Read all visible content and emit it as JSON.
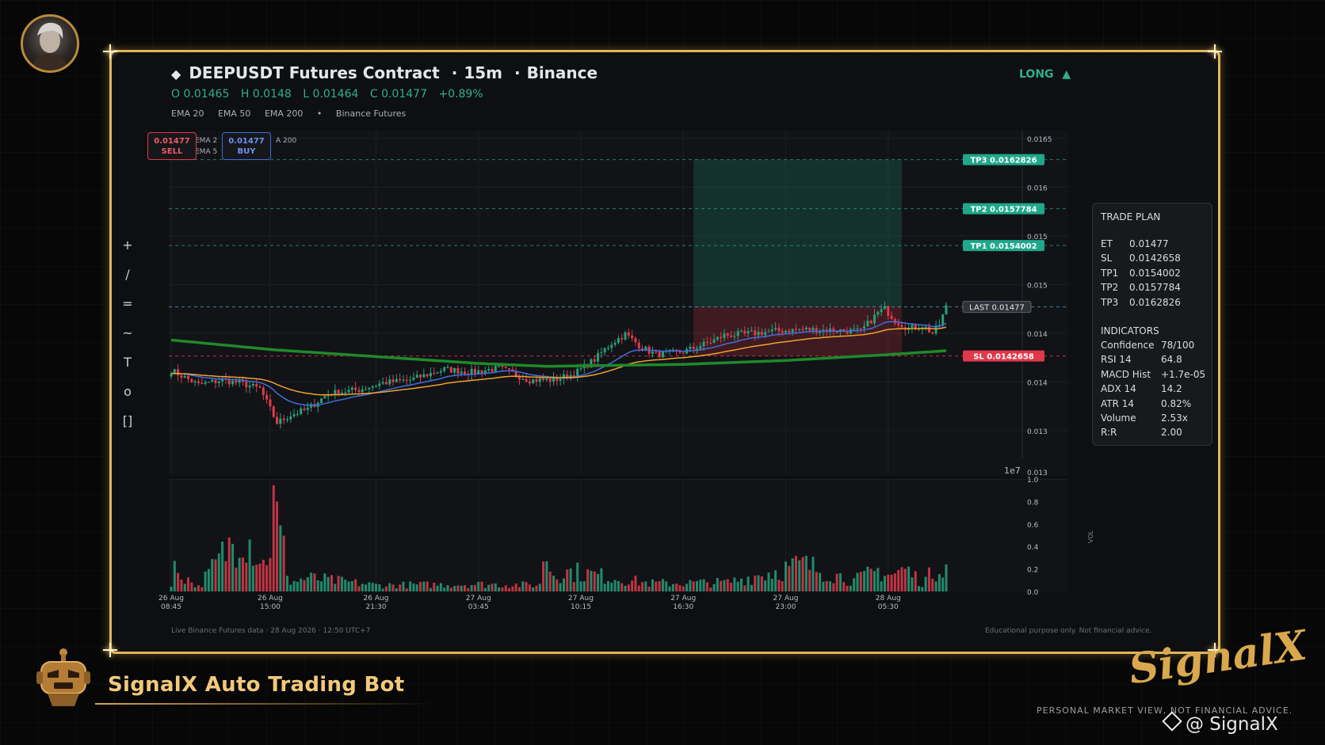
{
  "header": {
    "symbol_icon": "diamond-icon",
    "title": "DEEPUSDT Futures Contract",
    "interval": "15m",
    "exchange": "Binance",
    "ohlc": {
      "open": "O 0.01465",
      "high": "H 0.0148",
      "low": "L 0.01464",
      "close": "C 0.01477",
      "change": "+0.89%"
    },
    "indicators": [
      "EMA 20",
      "EMA 50",
      "EMA 200"
    ],
    "source": "Binance Futures",
    "separator": "·",
    "bullet": "•"
  },
  "signal": {
    "label": "LONG",
    "arrow": "▲",
    "color": "#2fb08a"
  },
  "toolbar": [
    "+",
    "/",
    "=",
    "~",
    "T",
    "o",
    "[]"
  ],
  "order_buttons": {
    "sell": {
      "price": "0.01477",
      "label": "SELL"
    },
    "buy": {
      "price": "0.01477",
      "label": "BUY"
    }
  },
  "legend_overlap": {
    "a": "EMA 2",
    "b": "EMA 5",
    "c": "A 200"
  },
  "price_tags": {
    "tp3": "TP3  0.0162826",
    "tp2": "TP2  0.0157784",
    "tp1": "TP1  0.0154002",
    "last": "LAST  0.01477",
    "sl": "SL  0.0142658"
  },
  "trade_plan": {
    "title": "TRADE PLAN",
    "rows": [
      {
        "k": "ET",
        "v": "0.01477"
      },
      {
        "k": "SL",
        "v": "0.0142658"
      },
      {
        "k": "TP1",
        "v": "0.0154002"
      },
      {
        "k": "TP2",
        "v": "0.0157784"
      },
      {
        "k": "TP3",
        "v": "0.0162826"
      }
    ],
    "ind_title": "INDICATORS",
    "indicators": [
      {
        "k": "Confidence",
        "v": "78/100"
      },
      {
        "k": "RSI 14",
        "v": "64.8"
      },
      {
        "k": "MACD Hist",
        "v": "+1.7e-05"
      },
      {
        "k": "ADX 14",
        "v": "14.2"
      },
      {
        "k": "ATR 14",
        "v": "0.82%"
      },
      {
        "k": "Volume",
        "v": "2.53x"
      },
      {
        "k": "R:R",
        "v": "2.00"
      }
    ]
  },
  "footer": {
    "left": "Live Binance Futures data  ·  28 Aug 2026 · 12:50 UTC+7",
    "right": "Educational purpose only. Not financial advice."
  },
  "branding": {
    "bot_title": "SignalX Auto Trading Bot",
    "logo_text": "SignalX",
    "note": "PERSONAL MARKET VIEW, NOT FINANCIAL ADVICE.",
    "handle": "@ SignalX"
  },
  "colors": {
    "up": "#26a17b",
    "down": "#e03b4a",
    "ema20": "#3f6fe0",
    "ema50": "#f0a22e",
    "ema200": "#1e8a2a",
    "tp": "#1fa88a",
    "sl": "#e0384a",
    "gold": "#e0b65a"
  },
  "chart_data": {
    "type": "candlestick",
    "price_axis": {
      "ticks": [
        "0.0165",
        "0.016",
        "0.015",
        "0.015",
        "0.014",
        "0.014",
        "0.013",
        "0.013"
      ],
      "ylim": [
        0.01306,
        0.01658
      ],
      "multiplier": "1e7"
    },
    "volume_axis": {
      "ticks": [
        "1.0",
        "0.8",
        "0.6",
        "0.4",
        "0.2",
        "0.0"
      ],
      "label": "VOL",
      "ylim": [
        0,
        1.0
      ]
    },
    "time_ticks": [
      "26 Aug\n08:45",
      "26 Aug\n15:00",
      "26 Aug\n21:30",
      "27 Aug\n03:45",
      "27 Aug\n10:15",
      "27 Aug\n16:30",
      "27 Aug\n23:00",
      "28 Aug\n05:30"
    ],
    "close_anchors": [
      [
        0,
        0.01412
      ],
      [
        8,
        0.01397
      ],
      [
        15,
        0.01402
      ],
      [
        21,
        0.01398
      ],
      [
        26,
        0.01393
      ],
      [
        29,
        0.01372
      ],
      [
        31,
        0.01358
      ],
      [
        35,
        0.01366
      ],
      [
        40,
        0.01372
      ],
      [
        46,
        0.01388
      ],
      [
        55,
        0.01392
      ],
      [
        62,
        0.01399
      ],
      [
        70,
        0.01402
      ],
      [
        80,
        0.01413
      ],
      [
        88,
        0.0141
      ],
      [
        96,
        0.01414
      ],
      [
        105,
        0.01402
      ],
      [
        112,
        0.01402
      ],
      [
        118,
        0.01408
      ],
      [
        124,
        0.01423
      ],
      [
        129,
        0.0144
      ],
      [
        133,
        0.01449
      ],
      [
        138,
        0.01435
      ],
      [
        142,
        0.01428
      ],
      [
        150,
        0.01431
      ],
      [
        158,
        0.01441
      ],
      [
        162,
        0.01448
      ],
      [
        168,
        0.01449
      ],
      [
        176,
        0.01452
      ],
      [
        185,
        0.01454
      ],
      [
        195,
        0.01453
      ],
      [
        202,
        0.01452
      ],
      [
        207,
        0.01471
      ],
      [
        209,
        0.01475
      ],
      [
        212,
        0.01463
      ],
      [
        216,
        0.01455
      ],
      [
        220,
        0.01458
      ],
      [
        223,
        0.0145
      ],
      [
        225,
        0.01459
      ],
      [
        227,
        0.01477
      ]
    ],
    "volume_anchors": [
      [
        0,
        0.05
      ],
      [
        1,
        0.25
      ],
      [
        8,
        0.05
      ],
      [
        21,
        0.7
      ],
      [
        27,
        0.3
      ],
      [
        29,
        0.52
      ],
      [
        30,
        0.95
      ],
      [
        35,
        0.1
      ],
      [
        40,
        0.15
      ],
      [
        60,
        0.07
      ],
      [
        90,
        0.08
      ],
      [
        108,
        0.07
      ],
      [
        109,
        0.44
      ],
      [
        112,
        0.2
      ],
      [
        118,
        0.22
      ],
      [
        140,
        0.09
      ],
      [
        163,
        0.1
      ],
      [
        185,
        0.3
      ],
      [
        200,
        0.12
      ],
      [
        207,
        0.23
      ],
      [
        211,
        0.18
      ],
      [
        215,
        0.25
      ],
      [
        220,
        0.1
      ],
      [
        226,
        0.32
      ]
    ],
    "ema200_anchors": [
      [
        0,
        0.01443
      ],
      [
        30,
        0.01433
      ],
      [
        60,
        0.01426
      ],
      [
        90,
        0.01419
      ],
      [
        110,
        0.01416
      ],
      [
        150,
        0.01418
      ],
      [
        180,
        0.01422
      ],
      [
        210,
        0.01428
      ],
      [
        227,
        0.01432
      ]
    ],
    "trade_zone": {
      "entry": 0.01477,
      "stop_loss": 0.0142658,
      "take_profit": 0.0162826,
      "start_index": 153,
      "end_index": 214
    },
    "levels": {
      "tp1": 0.0154002,
      "tp2": 0.0157784,
      "tp3": 0.0162826,
      "last": 0.01477,
      "sl": 0.0142658
    },
    "series": [
      {
        "name": "EMA 20"
      },
      {
        "name": "EMA 50"
      },
      {
        "name": "EMA 200"
      }
    ]
  }
}
